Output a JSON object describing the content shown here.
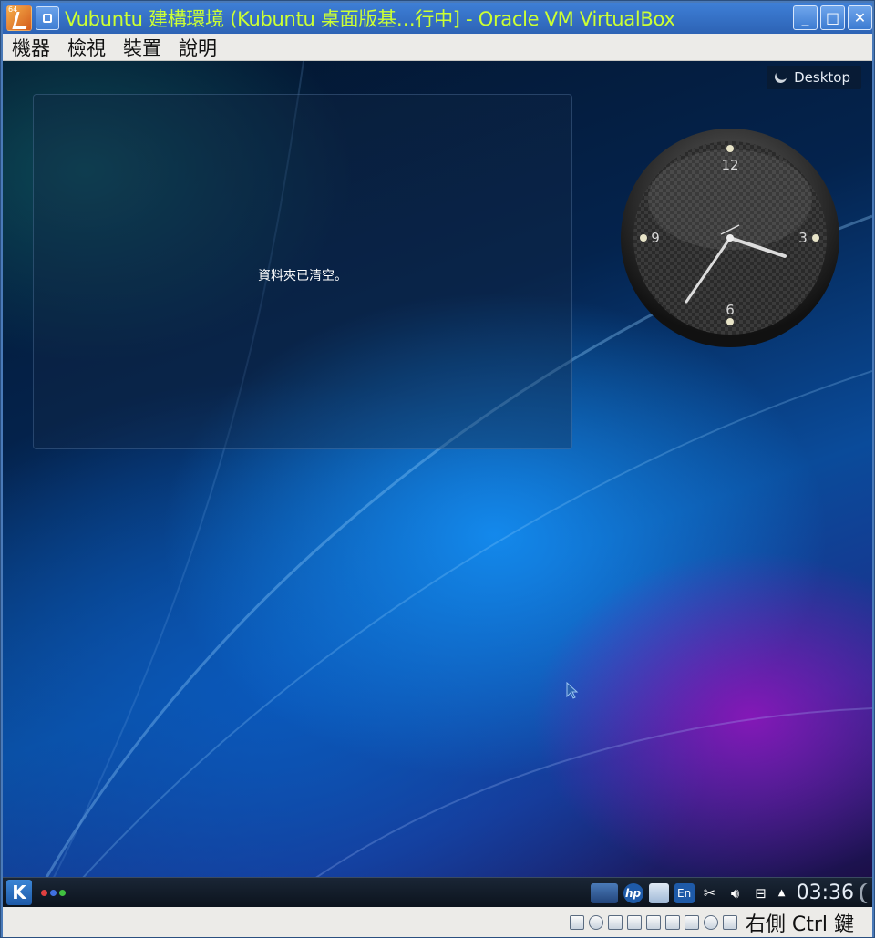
{
  "window": {
    "title": "Vubuntu 建構環境 (Kubuntu 桌面版基…行中] - Oracle VM VirtualBox",
    "controls": {
      "minimize": "_",
      "maximize": "□",
      "close": "✕"
    }
  },
  "menubar": {
    "items": [
      "機器",
      "檢視",
      "裝置",
      "說明"
    ]
  },
  "desktop": {
    "activity_label": "Desktop",
    "notification": "資料夾已清空。",
    "clock_numerals": {
      "twelve": "12",
      "three": "3",
      "six": "6",
      "nine": "9"
    }
  },
  "panel": {
    "launcher": "K",
    "tray": {
      "keyboard_layout": "En",
      "hp_label": "hp"
    },
    "time": "03:36"
  },
  "statusbar": {
    "host_key": "右側 Ctrl 鍵"
  },
  "colors": {
    "title_text": "#ccff33",
    "titlebar": "#2d63b5",
    "menubar": "#ecebe8",
    "panel": "#0c131d"
  }
}
